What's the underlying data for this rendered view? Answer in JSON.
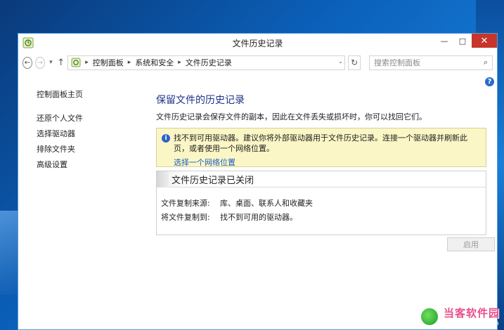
{
  "window": {
    "title": "文件历史记录",
    "controls": {
      "minimize": "—",
      "maximize": "□",
      "close": "✕"
    }
  },
  "nav": {
    "back": "←",
    "forward": "→",
    "recent": "▾",
    "up": "↑",
    "breadcrumbs": [
      "控制面板",
      "系统和安全",
      "文件历史记录"
    ],
    "dropdown": "⌄",
    "refresh": "↻",
    "search_placeholder": "搜索控制面板",
    "search_icon": "⌕"
  },
  "help_icon": "?",
  "sidebar": {
    "items": [
      {
        "label": "控制面板主页"
      },
      {
        "label": "还原个人文件"
      },
      {
        "label": "选择驱动器"
      },
      {
        "label": "排除文件夹"
      },
      {
        "label": "高级设置"
      }
    ]
  },
  "main": {
    "title": "保留文件的历史记录",
    "description": "文件历史记录会保存文件的副本，因此在文件丢失或损坏时，你可以找回它们。",
    "warning": {
      "icon": "i",
      "text": "找不到可用驱动器。建议你将外部驱动器用于文件历史记录。连接一个驱动器并刷新此页，或者使用一个网络位置。",
      "link": "选择一个网络位置"
    },
    "status": {
      "title": "文件历史记录已关闭",
      "rows": [
        {
          "label": "文件复制来源:",
          "value": "库、桌面、联系人和收藏夹"
        },
        {
          "label": "将文件复制到:",
          "value": "找不到可用的驱动器。"
        }
      ]
    },
    "enable_button": "启用"
  },
  "watermark": {
    "title": "当客软件园",
    "url": "www.downkr.com"
  }
}
